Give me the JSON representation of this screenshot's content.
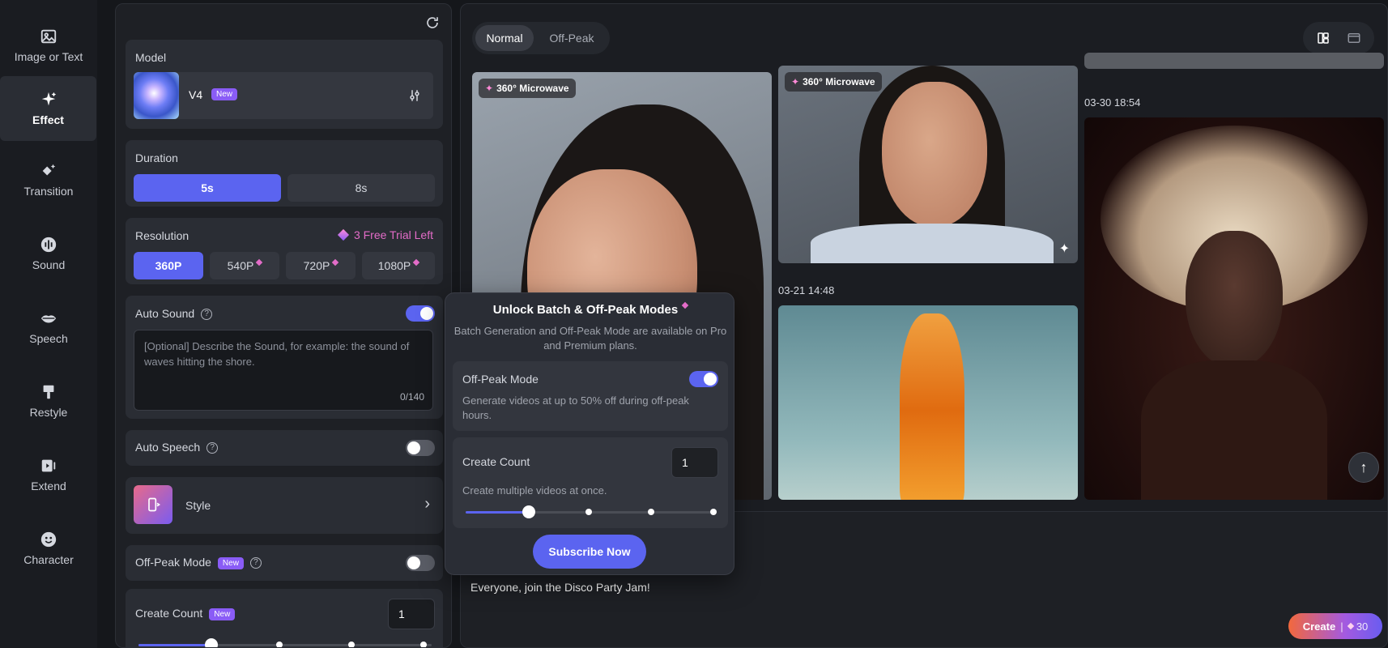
{
  "nav": {
    "items": [
      {
        "label": "Image or Text",
        "icon": "image-icon"
      },
      {
        "label": "Effect",
        "icon": "sparkle-icon",
        "active": true
      },
      {
        "label": "Transition",
        "icon": "transition-icon"
      },
      {
        "label": "Sound",
        "icon": "sound-wave-icon"
      },
      {
        "label": "Speech",
        "icon": "lips-icon"
      },
      {
        "label": "Restyle",
        "icon": "brush-icon"
      },
      {
        "label": "Extend",
        "icon": "extend-video-icon"
      },
      {
        "label": "Character",
        "icon": "smiley-face-icon"
      }
    ]
  },
  "settings": {
    "model": {
      "title": "Model",
      "name": "V4",
      "badge": "New"
    },
    "duration": {
      "title": "Duration",
      "options": [
        "5s",
        "8s"
      ],
      "selected": "5s"
    },
    "resolution": {
      "title": "Resolution",
      "trial": "3 Free Trial Left",
      "options": [
        "360P",
        "540P",
        "720P",
        "1080P"
      ],
      "selected": "360P"
    },
    "auto_sound": {
      "title": "Auto Sound",
      "enabled": true,
      "placeholder": "[Optional] Describe the Sound, for example: the sound of waves hitting the shore.",
      "counter": "0/140"
    },
    "auto_speech": {
      "title": "Auto Speech",
      "enabled": false
    },
    "style": {
      "title": "Style"
    },
    "off_peak": {
      "title": "Off-Peak Mode",
      "badge": "New",
      "enabled": false
    },
    "create_count": {
      "title": "Create Count",
      "badge": "New",
      "value": "1"
    }
  },
  "gallery": {
    "modes": [
      "Normal",
      "Off-Peak"
    ],
    "selected_mode": "Normal",
    "tag": "360° Microwave",
    "dates": [
      "03-30 18:54",
      "03-21 14:48"
    ],
    "prompt": "Everyone, join the Disco Party Jam!",
    "create_button": "Create",
    "credits": "30"
  },
  "popup": {
    "title": "Unlock Batch & Off-Peak Modes",
    "subtitle": "Batch Generation and Off-Peak Mode are available on Pro and Premium plans.",
    "off_peak_title": "Off-Peak Mode",
    "off_peak_desc": "Generate videos at up to 50% off during off-peak hours.",
    "count_title": "Create Count",
    "count_value": "1",
    "count_desc": "Create multiple videos at once.",
    "subscribe": "Subscribe Now"
  },
  "colors": {
    "accent": "#5b64f0",
    "gem": "#e36cc8",
    "create_gradient_start": "#f2683c",
    "create_gradient_end": "#7a5cf0"
  }
}
